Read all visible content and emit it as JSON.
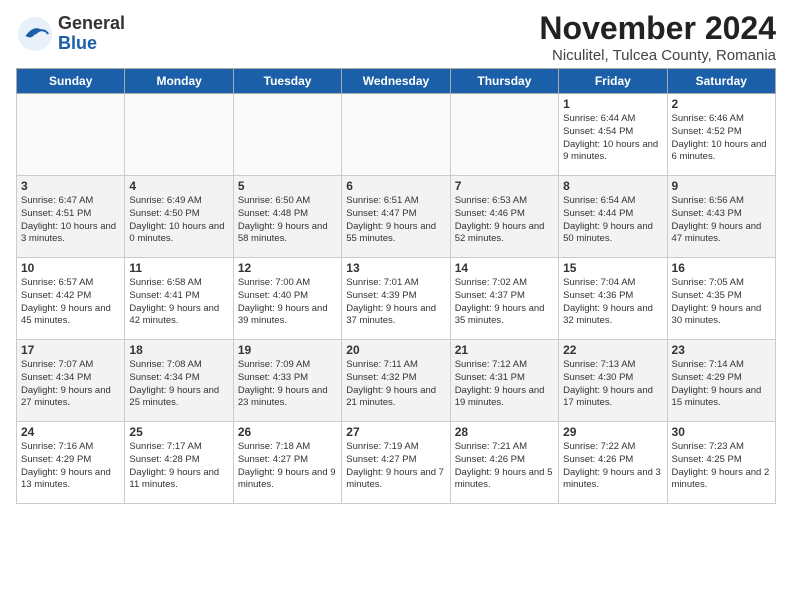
{
  "logo": {
    "general": "General",
    "blue": "Blue"
  },
  "title": "November 2024",
  "location": "Niculitel, Tulcea County, Romania",
  "days_of_week": [
    "Sunday",
    "Monday",
    "Tuesday",
    "Wednesday",
    "Thursday",
    "Friday",
    "Saturday"
  ],
  "weeks": [
    [
      {
        "day": "",
        "info": ""
      },
      {
        "day": "",
        "info": ""
      },
      {
        "day": "",
        "info": ""
      },
      {
        "day": "",
        "info": ""
      },
      {
        "day": "",
        "info": ""
      },
      {
        "day": "1",
        "info": "Sunrise: 6:44 AM\nSunset: 4:54 PM\nDaylight: 10 hours and 9 minutes."
      },
      {
        "day": "2",
        "info": "Sunrise: 6:46 AM\nSunset: 4:52 PM\nDaylight: 10 hours and 6 minutes."
      }
    ],
    [
      {
        "day": "3",
        "info": "Sunrise: 6:47 AM\nSunset: 4:51 PM\nDaylight: 10 hours and 3 minutes."
      },
      {
        "day": "4",
        "info": "Sunrise: 6:49 AM\nSunset: 4:50 PM\nDaylight: 10 hours and 0 minutes."
      },
      {
        "day": "5",
        "info": "Sunrise: 6:50 AM\nSunset: 4:48 PM\nDaylight: 9 hours and 58 minutes."
      },
      {
        "day": "6",
        "info": "Sunrise: 6:51 AM\nSunset: 4:47 PM\nDaylight: 9 hours and 55 minutes."
      },
      {
        "day": "7",
        "info": "Sunrise: 6:53 AM\nSunset: 4:46 PM\nDaylight: 9 hours and 52 minutes."
      },
      {
        "day": "8",
        "info": "Sunrise: 6:54 AM\nSunset: 4:44 PM\nDaylight: 9 hours and 50 minutes."
      },
      {
        "day": "9",
        "info": "Sunrise: 6:56 AM\nSunset: 4:43 PM\nDaylight: 9 hours and 47 minutes."
      }
    ],
    [
      {
        "day": "10",
        "info": "Sunrise: 6:57 AM\nSunset: 4:42 PM\nDaylight: 9 hours and 45 minutes."
      },
      {
        "day": "11",
        "info": "Sunrise: 6:58 AM\nSunset: 4:41 PM\nDaylight: 9 hours and 42 minutes."
      },
      {
        "day": "12",
        "info": "Sunrise: 7:00 AM\nSunset: 4:40 PM\nDaylight: 9 hours and 39 minutes."
      },
      {
        "day": "13",
        "info": "Sunrise: 7:01 AM\nSunset: 4:39 PM\nDaylight: 9 hours and 37 minutes."
      },
      {
        "day": "14",
        "info": "Sunrise: 7:02 AM\nSunset: 4:37 PM\nDaylight: 9 hours and 35 minutes."
      },
      {
        "day": "15",
        "info": "Sunrise: 7:04 AM\nSunset: 4:36 PM\nDaylight: 9 hours and 32 minutes."
      },
      {
        "day": "16",
        "info": "Sunrise: 7:05 AM\nSunset: 4:35 PM\nDaylight: 9 hours and 30 minutes."
      }
    ],
    [
      {
        "day": "17",
        "info": "Sunrise: 7:07 AM\nSunset: 4:34 PM\nDaylight: 9 hours and 27 minutes."
      },
      {
        "day": "18",
        "info": "Sunrise: 7:08 AM\nSunset: 4:34 PM\nDaylight: 9 hours and 25 minutes."
      },
      {
        "day": "19",
        "info": "Sunrise: 7:09 AM\nSunset: 4:33 PM\nDaylight: 9 hours and 23 minutes."
      },
      {
        "day": "20",
        "info": "Sunrise: 7:11 AM\nSunset: 4:32 PM\nDaylight: 9 hours and 21 minutes."
      },
      {
        "day": "21",
        "info": "Sunrise: 7:12 AM\nSunset: 4:31 PM\nDaylight: 9 hours and 19 minutes."
      },
      {
        "day": "22",
        "info": "Sunrise: 7:13 AM\nSunset: 4:30 PM\nDaylight: 9 hours and 17 minutes."
      },
      {
        "day": "23",
        "info": "Sunrise: 7:14 AM\nSunset: 4:29 PM\nDaylight: 9 hours and 15 minutes."
      }
    ],
    [
      {
        "day": "24",
        "info": "Sunrise: 7:16 AM\nSunset: 4:29 PM\nDaylight: 9 hours and 13 minutes."
      },
      {
        "day": "25",
        "info": "Sunrise: 7:17 AM\nSunset: 4:28 PM\nDaylight: 9 hours and 11 minutes."
      },
      {
        "day": "26",
        "info": "Sunrise: 7:18 AM\nSunset: 4:27 PM\nDaylight: 9 hours and 9 minutes."
      },
      {
        "day": "27",
        "info": "Sunrise: 7:19 AM\nSunset: 4:27 PM\nDaylight: 9 hours and 7 minutes."
      },
      {
        "day": "28",
        "info": "Sunrise: 7:21 AM\nSunset: 4:26 PM\nDaylight: 9 hours and 5 minutes."
      },
      {
        "day": "29",
        "info": "Sunrise: 7:22 AM\nSunset: 4:26 PM\nDaylight: 9 hours and 3 minutes."
      },
      {
        "day": "30",
        "info": "Sunrise: 7:23 AM\nSunset: 4:25 PM\nDaylight: 9 hours and 2 minutes."
      }
    ]
  ]
}
